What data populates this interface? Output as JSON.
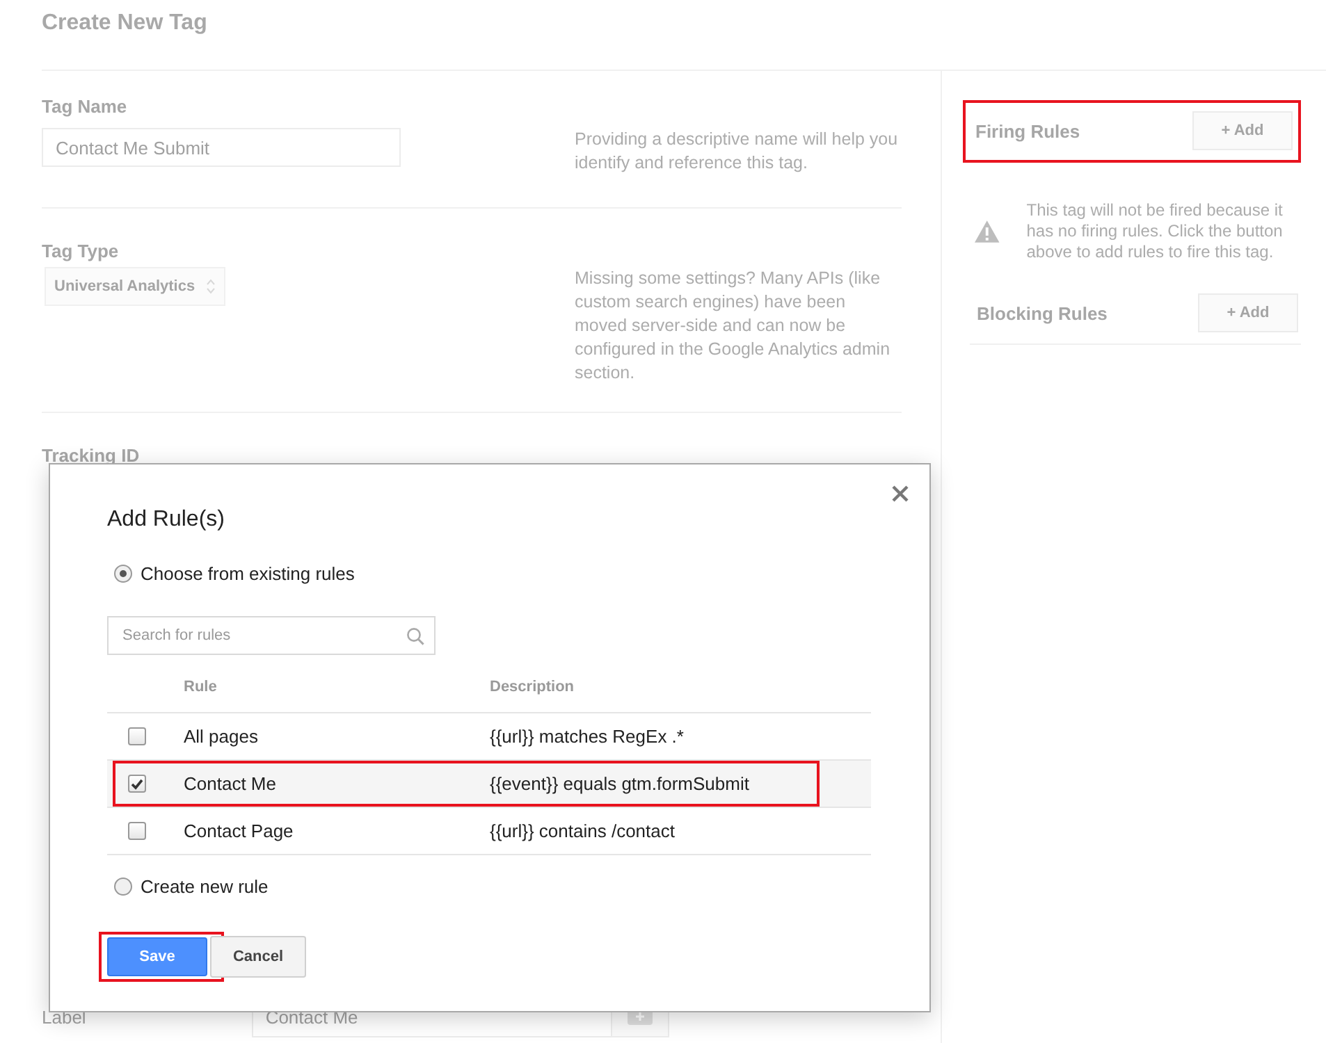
{
  "page": {
    "title": "Create New Tag"
  },
  "form": {
    "sections": [
      {
        "kind": "text",
        "label": "Tag Name",
        "value": "Contact Me Submit",
        "help": "Providing a descriptive name will help you identify and reference this tag."
      },
      {
        "kind": "select",
        "label": "Tag Type",
        "value": "Universal Analytics",
        "help": "Missing some settings? Many APIs (like custom search engines) have been moved server-side and can now be configured in the Google Analytics admin section."
      },
      {
        "kind": "heading",
        "label": "Tracking ID"
      }
    ],
    "label_row": {
      "label": "Label",
      "value": "Contact Me"
    }
  },
  "side": {
    "firing_rules": {
      "title": "Firing Rules",
      "button": "+ Add",
      "highlighted": true
    },
    "warning": "This tag will not be fired because it has no firing rules. Click the button above to add rules to fire this tag.",
    "blocking_rules": {
      "title": "Blocking Rules",
      "button": "+ Add",
      "highlighted": false
    }
  },
  "dialog": {
    "title": "Add Rule(s)",
    "options": [
      {
        "label": "Choose from existing rules",
        "selected": true
      },
      {
        "label": "Create new rule",
        "selected": false
      }
    ],
    "search": {
      "placeholder": "Search for rules"
    },
    "columns": [
      "Rule",
      "Description"
    ],
    "rows": [
      {
        "rule": "All pages",
        "description": "{{url}} matches RegEx .*",
        "checked": false,
        "highlighted": false
      },
      {
        "rule": "Contact Me",
        "description": "{{event}} equals gtm.formSubmit",
        "checked": true,
        "highlighted": true
      },
      {
        "rule": "Contact Page",
        "description": "{{url}} contains /contact",
        "checked": false,
        "highlighted": false
      }
    ],
    "save": {
      "label": "Save",
      "highlighted": true
    },
    "cancel": {
      "label": "Cancel"
    }
  }
}
